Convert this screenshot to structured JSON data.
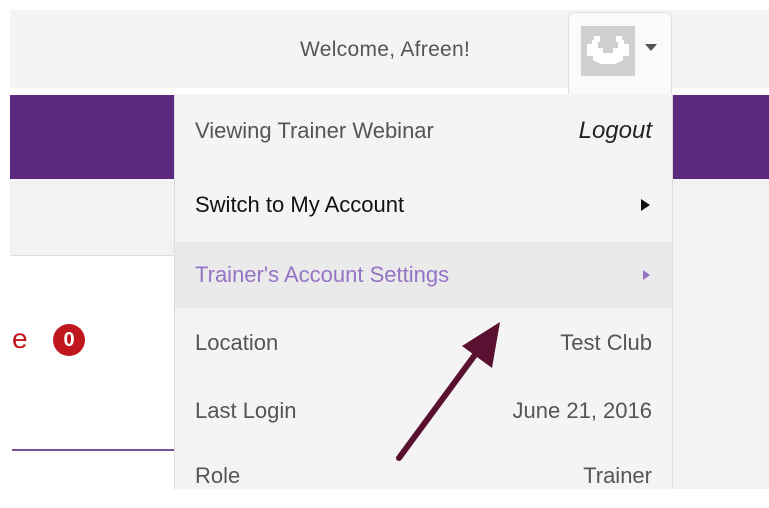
{
  "header": {
    "welcome_text": "Welcome, Afreen!",
    "avatar_icon": "flexing-arms-icon",
    "caret_icon": "caret-down-icon"
  },
  "background": {
    "partial_text": "e",
    "badge_count": "0"
  },
  "dropdown": {
    "viewing_label": "Viewing Trainer Webinar",
    "logout_label": "Logout",
    "menu_items": [
      {
        "label": "Switch to My Account",
        "icon": "triangle-right-icon"
      },
      {
        "label": "Trainer's Account Settings",
        "icon": "triangle-right-icon",
        "highlighted": true
      }
    ],
    "info": [
      {
        "label": "Location",
        "value": "Test Club"
      },
      {
        "label": "Last Login",
        "value": "June 21, 2016"
      },
      {
        "label": "Role",
        "value": "Trainer"
      }
    ]
  },
  "colors": {
    "brand_purple": "#5b2a7e",
    "highlight_text": "#9574c6",
    "alert_red": "#c0161d",
    "annotation_arrow": "#5a1030"
  }
}
